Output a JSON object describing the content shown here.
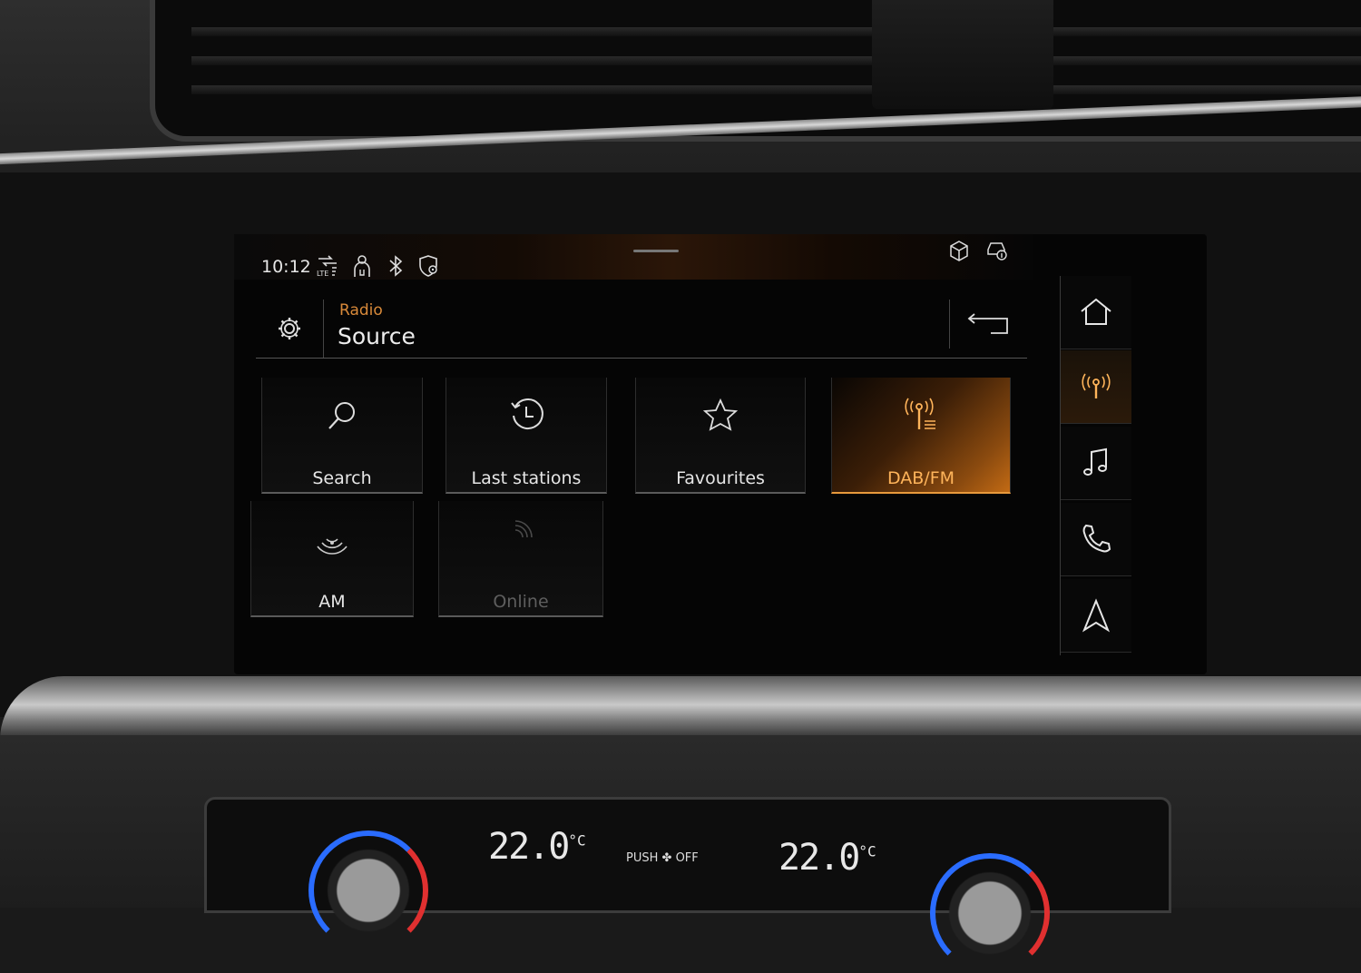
{
  "status_bar": {
    "time": "10:12",
    "icons": [
      "lte-data-icon",
      "driver-assist-icon",
      "bluetooth-icon",
      "location-shield-icon"
    ],
    "right_icons": [
      "package-icon",
      "car-info-icon"
    ]
  },
  "header": {
    "breadcrumb": "Radio",
    "title": "Source"
  },
  "sources": [
    {
      "label": "Search",
      "icon": "search-icon",
      "state": "normal"
    },
    {
      "label": "Last stations",
      "icon": "history-clock-icon",
      "state": "normal"
    },
    {
      "label": "Favourites",
      "icon": "star-icon",
      "state": "normal"
    },
    {
      "label": "DAB/FM",
      "icon": "dab-antenna-icon",
      "state": "selected"
    },
    {
      "label": "AM",
      "icon": "am-signal-icon",
      "state": "normal"
    },
    {
      "label": "Online",
      "icon": "online-signal-icon",
      "state": "disabled"
    }
  ],
  "side_nav": [
    {
      "name": "home",
      "icon": "home-icon"
    },
    {
      "name": "radio",
      "icon": "radio-antenna-icon",
      "active": true
    },
    {
      "name": "media",
      "icon": "music-note-icon"
    },
    {
      "name": "phone",
      "icon": "phone-icon"
    },
    {
      "name": "navigation",
      "icon": "navigation-arrow-icon"
    }
  ],
  "climate": {
    "left_temp": "22.0",
    "right_temp": "22.0",
    "unit": "°C",
    "push_label": "PUSH",
    "off_label": "OFF"
  },
  "colors": {
    "accent": "#e89a3c",
    "accent_text": "#d98a3a",
    "screen_bg": "#050505"
  }
}
